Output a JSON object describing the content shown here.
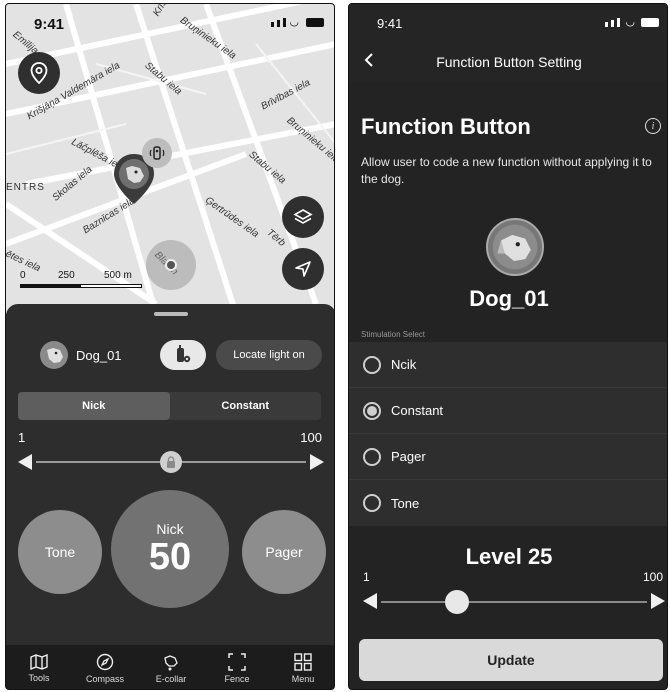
{
  "left": {
    "status": {
      "time": "9:41"
    },
    "map": {
      "streets": [
        "Krišjāņa Valdemāra iela",
        "Stabu iela",
        "Lāčplēša iela",
        "Skolas iela",
        "Baznīcas iela",
        "Ģertrūdes iela",
        "Brīvības iela",
        "Bruņinieku iela",
        "Emīlija",
        "Krīša",
        "Tērb",
        "Blaum",
        "ētes iela",
        "Bruņinieku iela",
        "Stabu iela",
        "ENTRS"
      ],
      "scale_labels": [
        "0",
        "250",
        "500 m"
      ],
      "icons": [
        "location-pin-icon",
        "layers-icon",
        "navigate-icon",
        "dog-marker-icon",
        "collar-device-icon"
      ]
    },
    "sheet": {
      "dog_name": "Dog_01",
      "locate_label": "Locate light on",
      "tabs": [
        "Nick",
        "Constant"
      ],
      "active_tab": 0,
      "range_min": "1",
      "range_max": "100",
      "slider_level": 0.5,
      "tone_label": "Tone",
      "pager_label": "Pager",
      "center_label": "Nick",
      "center_value": "50"
    },
    "tabbar": [
      {
        "label": "Tools",
        "icon": "map-icon"
      },
      {
        "label": "Compass",
        "icon": "compass-icon"
      },
      {
        "label": "E-collar",
        "icon": "e-collar-icon"
      },
      {
        "label": "Fence",
        "icon": "fence-icon"
      },
      {
        "label": "Menu",
        "icon": "menu-grid-icon"
      }
    ]
  },
  "right": {
    "status": {
      "time": "9:41"
    },
    "nav_title": "Function Button Setting",
    "heading": "Function Button",
    "description": "Allow user to code a new function without applying it to the dog.",
    "dog_name": "Dog_01",
    "section_label": "Stimulation Select",
    "options": [
      "Ncik",
      "Constant",
      "Pager",
      "Tone"
    ],
    "selected_option": 1,
    "level_label": "Level 25",
    "range_min": "1",
    "range_max": "100",
    "slider_level": 0.25,
    "update_label": "Update"
  }
}
